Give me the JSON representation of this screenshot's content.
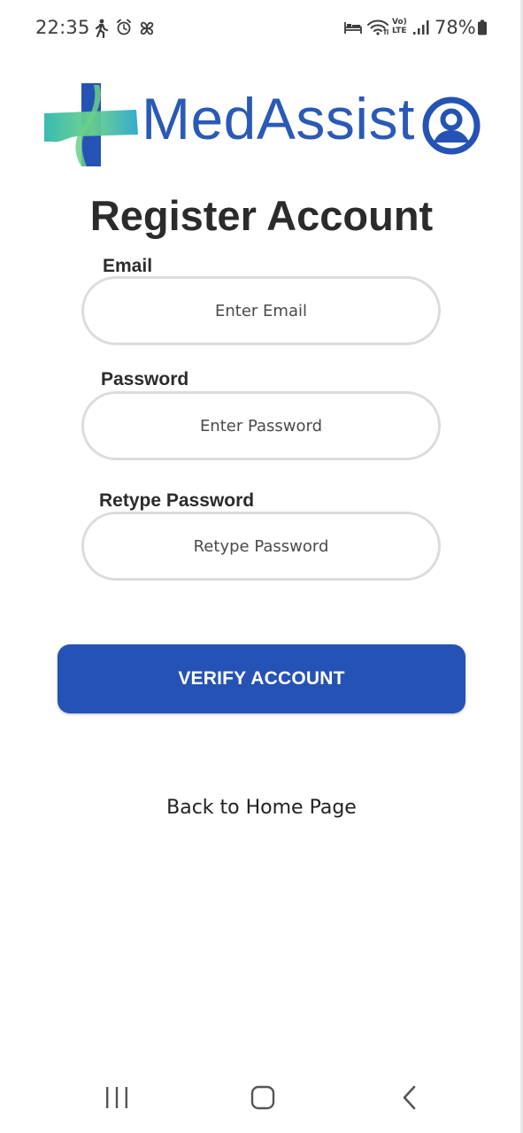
{
  "status_bar": {
    "time": "22:35",
    "battery": "78%",
    "icons": [
      "walking-icon",
      "alarm-icon",
      "pinwheel-icon",
      "bed-icon",
      "wifi-icon",
      "volte-icon",
      "signal-icon",
      "battery-icon"
    ],
    "volte_top": "Vo)",
    "volte_bottom": "LTE"
  },
  "logo": {
    "text": "MedAssist",
    "colors": {
      "brand_blue": "#2a5ab5",
      "cross_teal": "#2fb8b0",
      "cross_green": "#6bd08a"
    }
  },
  "page": {
    "title": "Register Account"
  },
  "form": {
    "email": {
      "label": "Email",
      "placeholder": "Enter Email"
    },
    "password": {
      "label": "Password",
      "placeholder": "Enter Password"
    },
    "retype": {
      "label": "Retype Password",
      "placeholder": "Retype Password"
    },
    "submit_label": "VERIFY ACCOUNT",
    "accent": "#2553b5"
  },
  "links": {
    "back_home": "Back to Home Page"
  },
  "nav_bar": {
    "buttons": [
      "recent-apps-icon",
      "home-icon",
      "back-icon"
    ]
  }
}
